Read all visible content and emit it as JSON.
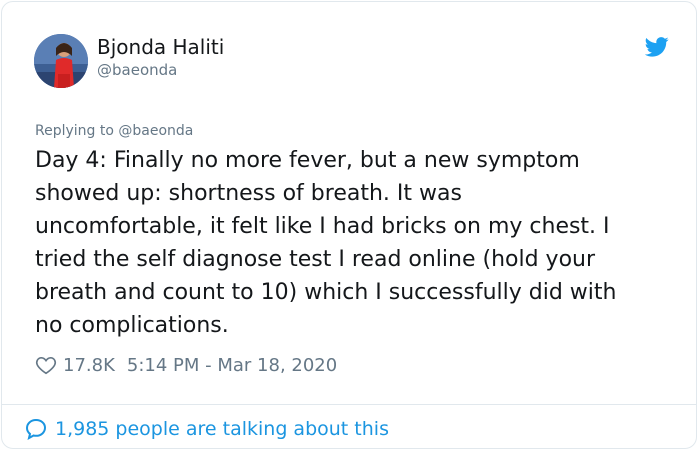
{
  "user": {
    "display_name": "Bjonda Haliti",
    "handle": "@baeonda"
  },
  "reply": {
    "prefix": "Replying to ",
    "mention": "@baeonda"
  },
  "tweet": {
    "text": "Day 4: Finally no more fever, but a new symptom\nshowed up: shortness of breath. It was\nuncomfortable, it felt like I had bricks on my chest. I\ntried the self diagnose test I read online (hold your\nbreath and count to 10) which I successfully did with\nno complications."
  },
  "meta": {
    "likes": "17.8K",
    "timestamp": "5:14 PM - Mar 18, 2020"
  },
  "footer": {
    "talking": "1,985 people are talking about this"
  },
  "icons": {
    "brand": "twitter-bird-icon",
    "like": "heart-icon",
    "conversation": "speech-bubble-icon"
  },
  "colors": {
    "brand_blue": "#1da1f2",
    "link_blue": "#1b95e0",
    "secondary_text": "#657786",
    "primary_text": "#14171a"
  }
}
